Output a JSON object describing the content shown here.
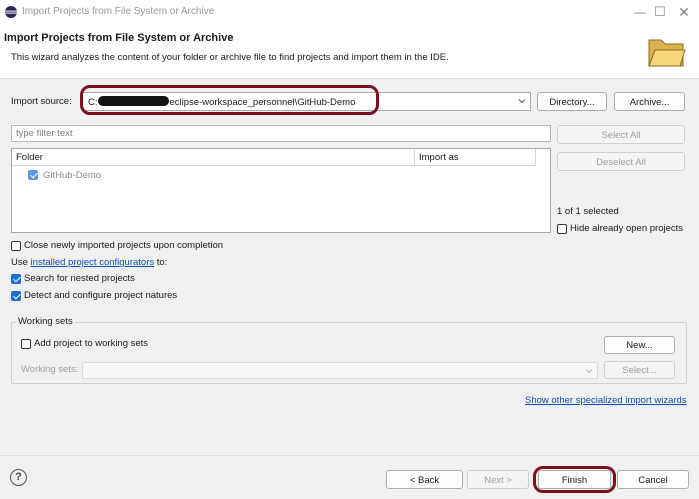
{
  "window": {
    "title": "Import Projects from File System or Archive",
    "minimize_glyph": "—",
    "maximize_glyph": "☐",
    "close_glyph": "✕"
  },
  "header": {
    "title": "Import Projects from File System or Archive",
    "description": "This wizard analyzes the content of your folder or archive file to find projects and import them in the IDE."
  },
  "import_source": {
    "label": "Import source:",
    "value_prefix": "C:",
    "value_suffix": "eclipse-workspace_personnel\\GitHub-Demo",
    "directory_button": "Directory...",
    "archive_button": "Archive..."
  },
  "filter": {
    "placeholder": "type filter text"
  },
  "selection_buttons": {
    "select_all": "Select All",
    "deselect_all": "Deselect All"
  },
  "table": {
    "columns": [
      "Folder",
      "Import as"
    ],
    "rows": [
      {
        "folder": "GitHub-Demo",
        "import_as": "",
        "checked": true
      }
    ]
  },
  "selection_status": "1 of 1 selected",
  "options": {
    "hide_open_projects": "Hide already open projects",
    "close_imported": "Close newly imported projects upon completion",
    "use_prefix": "Use ",
    "configurators_link": "installed project configurators",
    "use_suffix": " to:",
    "search_nested": "Search for nested projects",
    "detect_natures": "Detect and configure project natures"
  },
  "working_sets": {
    "title": "Working sets",
    "add_label": "Add project to working sets",
    "new_button": "New...",
    "sets_label": "Working sets:",
    "select_button": "Select..."
  },
  "specialized_link": "Show other specialized import wizards",
  "footer": {
    "help_glyph": "?",
    "back": "< Back",
    "next": "Next >",
    "finish": "Finish",
    "cancel": "Cancel"
  },
  "colors": {
    "highlight": "#7a1020",
    "link": "#0b4fb0",
    "check": "#1b6ed6"
  }
}
